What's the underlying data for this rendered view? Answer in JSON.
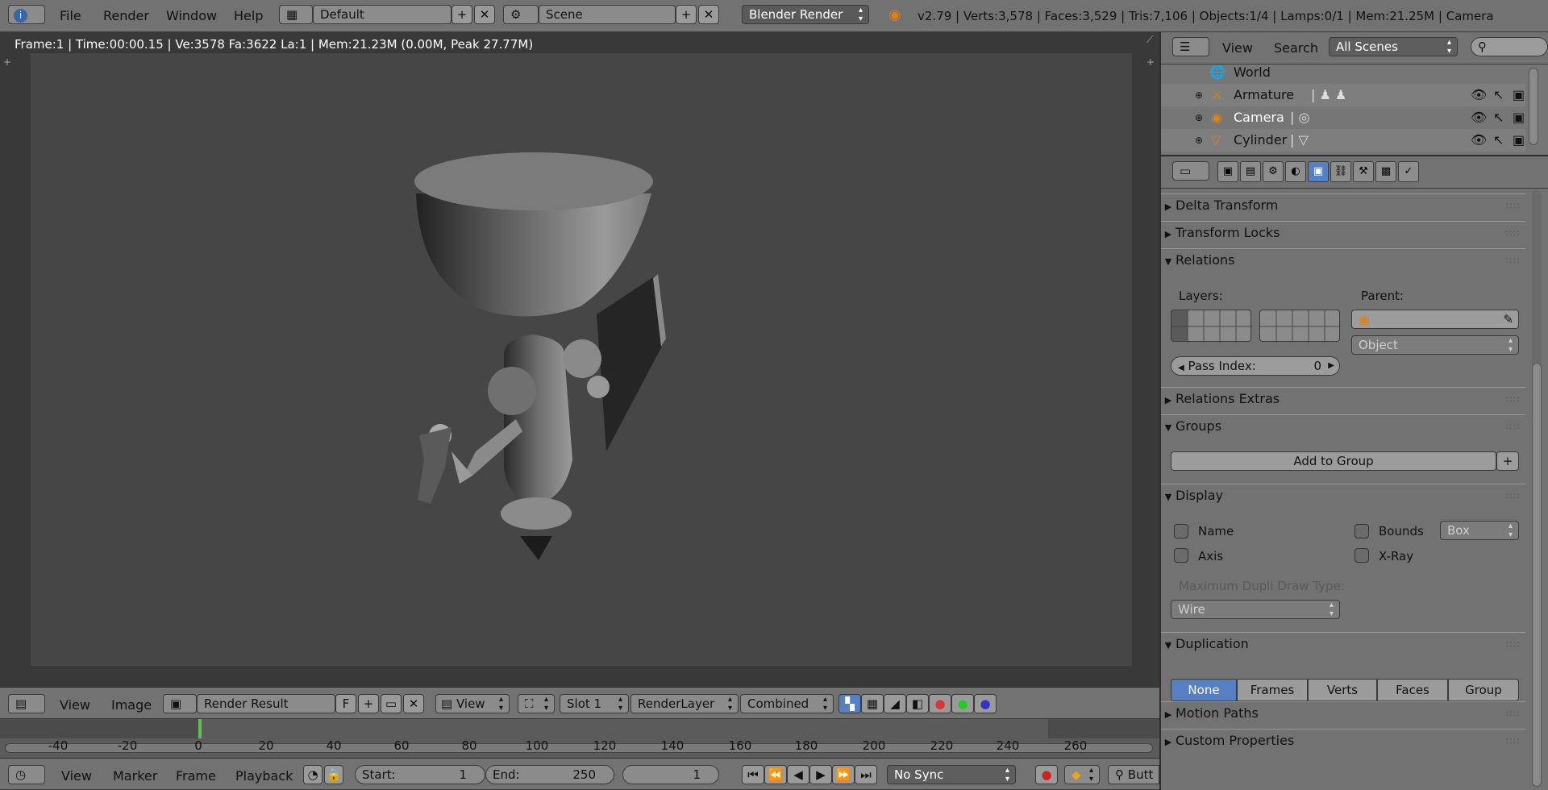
{
  "topbar": {
    "menus": [
      "File",
      "Render",
      "Window",
      "Help"
    ],
    "screen_layout": "Default",
    "scene": "Scene",
    "engine": "Blender Render",
    "stats": "v2.79 | Verts:3,578 | Faces:3,529 | Tris:7,106 | Objects:1/4 | Lamps:0/1 | Mem:21.25M | Camera"
  },
  "viewport": {
    "info": "Frame:1 | Time:00:00.15 | Ve:3578 Fa:3622 La:1 | Mem:21.23M (0.00M, Peak 27.77M)"
  },
  "image_editor": {
    "view": "View",
    "image": "Image",
    "image_name": "Render Result",
    "fake_user": "F",
    "view_select": "View",
    "slot": "Slot 1",
    "layer": "RenderLayer",
    "pass": "Combined"
  },
  "timeline": {
    "ticks": [
      "-40",
      "-20",
      "0",
      "20",
      "40",
      "60",
      "80",
      "100",
      "120",
      "140",
      "160",
      "180",
      "200",
      "220",
      "240",
      "260"
    ],
    "menus": [
      "View",
      "Marker",
      "Frame",
      "Playback"
    ],
    "start_label": "Start:",
    "start_value": "1",
    "end_label": "End:",
    "end_value": "250",
    "current": "1",
    "sync": "No Sync",
    "keying": "Butt"
  },
  "outliner": {
    "view": "View",
    "search": "Search",
    "filter": "All Scenes",
    "items": [
      "World",
      "Armature",
      "Camera",
      "Cylinder"
    ]
  },
  "properties": {
    "panels": {
      "delta_transform": "Delta Transform",
      "transform_locks": "Transform Locks",
      "relations": "Relations",
      "relations_extras": "Relations Extras",
      "groups": "Groups",
      "display": "Display",
      "duplication": "Duplication",
      "motion_paths": "Motion Paths",
      "custom_properties": "Custom Properties"
    },
    "relations": {
      "layers_label": "Layers:",
      "parent_label": "Parent:",
      "parent_type": "Object",
      "pass_index_label": "Pass Index:",
      "pass_index_value": "0"
    },
    "groups": {
      "add_to_group": "Add to Group"
    },
    "display": {
      "name": "Name",
      "axis": "Axis",
      "bounds": "Bounds",
      "bounds_type": "Box",
      "xray": "X-Ray",
      "dupli_label": "Maximum Dupli Draw Type:",
      "dupli_value": "Wire"
    },
    "duplication": {
      "tabs": [
        "None",
        "Frames",
        "Verts",
        "Faces",
        "Group"
      ],
      "active": "None"
    }
  }
}
